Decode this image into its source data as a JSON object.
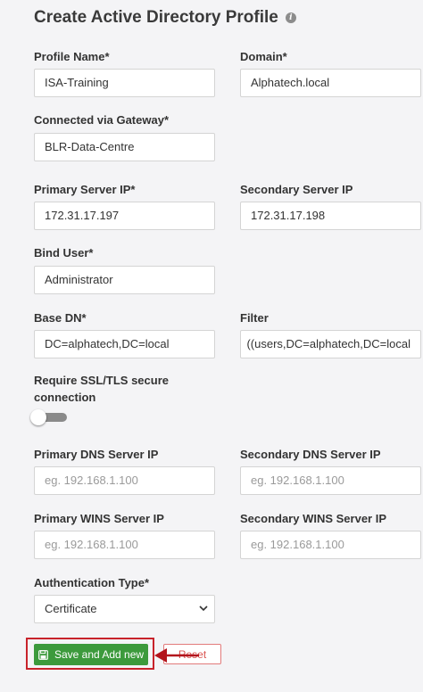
{
  "form": {
    "title": "Create Active Directory Profile",
    "profile_name": {
      "label": "Profile Name*",
      "value": "ISA-Training"
    },
    "domain": {
      "label": "Domain*",
      "value": "Alphatech.local"
    },
    "gateway": {
      "label": "Connected via Gateway*",
      "value": "BLR-Data-Centre"
    },
    "primary_server_ip": {
      "label": "Primary Server IP*",
      "value": "172.31.17.197"
    },
    "secondary_server_ip": {
      "label": "Secondary Server IP",
      "value": "172.31.17.198"
    },
    "bind_user": {
      "label": "Bind User*",
      "value": "Administrator"
    },
    "base_dn": {
      "label": "Base DN*",
      "value": "DC=alphatech,DC=local"
    },
    "filter": {
      "label": "Filter",
      "value": "users,DC=alphatech,DC=local))"
    },
    "ssl": {
      "label_line1": "Require SSL/TLS secure",
      "label_line2": "connection",
      "enabled": false
    },
    "primary_dns": {
      "label": "Primary DNS Server IP",
      "placeholder": "eg. 192.168.1.100"
    },
    "secondary_dns": {
      "label": "Secondary DNS Server IP",
      "placeholder": "eg. 192.168.1.100"
    },
    "primary_wins": {
      "label": "Primary WINS Server IP",
      "placeholder": "eg. 192.168.1.100"
    },
    "secondary_wins": {
      "label": "Secondary WINS Server IP",
      "placeholder": "eg. 192.168.1.100"
    },
    "auth_type": {
      "label": "Authentication Type*",
      "selected": "Certificate"
    }
  },
  "actions": {
    "save_label": "Save and Add new",
    "reset_label": "Reset"
  },
  "icons": {
    "info": "info-icon",
    "chevron": "chevron-down-icon",
    "save": "floppy-disk-icon"
  },
  "colors": {
    "save_button": "#3c9a3c",
    "reset_text": "#d9534f",
    "highlight": "#c8232b",
    "toggle_off": "#8a8a8a"
  }
}
